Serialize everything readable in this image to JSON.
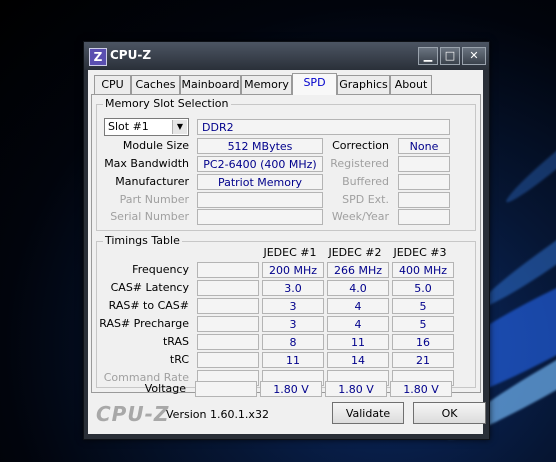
{
  "window": {
    "title": "CPU-Z",
    "icon_letter": "Z"
  },
  "tabs": [
    "CPU",
    "Caches",
    "Mainboard",
    "Memory",
    "SPD",
    "Graphics",
    "About"
  ],
  "active_tab": "SPD",
  "slot_selection": {
    "group_label": "Memory Slot Selection",
    "selected_slot": "Slot #1",
    "memory_type": "DDR2",
    "module_size_label": "Module Size",
    "module_size": "512 MBytes",
    "max_bandwidth_label": "Max Bandwidth",
    "max_bandwidth": "PC2-6400 (400 MHz)",
    "manufacturer_label": "Manufacturer",
    "manufacturer": "Patriot Memory",
    "part_number_label": "Part Number",
    "part_number": "",
    "serial_number_label": "Serial Number",
    "serial_number": "",
    "correction_label": "Correction",
    "correction": "None",
    "registered_label": "Registered",
    "registered": "",
    "buffered_label": "Buffered",
    "buffered": "",
    "spd_ext_label": "SPD Ext.",
    "spd_ext": "",
    "week_year_label": "Week/Year",
    "week_year": ""
  },
  "timings": {
    "group_label": "Timings Table",
    "columns": [
      "JEDEC #1",
      "JEDEC #2",
      "JEDEC #3"
    ],
    "rows": [
      {
        "label": "Frequency",
        "values": [
          "200 MHz",
          "266 MHz",
          "400 MHz"
        ]
      },
      {
        "label": "CAS# Latency",
        "values": [
          "3.0",
          "4.0",
          "5.0"
        ]
      },
      {
        "label": "RAS# to CAS#",
        "values": [
          "3",
          "4",
          "5"
        ]
      },
      {
        "label": "RAS# Precharge",
        "values": [
          "3",
          "4",
          "5"
        ]
      },
      {
        "label": "tRAS",
        "values": [
          "8",
          "11",
          "16"
        ]
      },
      {
        "label": "tRC",
        "values": [
          "11",
          "14",
          "21"
        ]
      },
      {
        "label": "Command Rate",
        "values": [
          "",
          "",
          ""
        ]
      },
      {
        "label": "Voltage",
        "values": [
          "1.80 V",
          "1.80 V",
          "1.80 V"
        ]
      }
    ]
  },
  "footer": {
    "logo": "CPU-Z",
    "version": "Version 1.60.1.x32",
    "validate_label": "Validate",
    "ok_label": "OK"
  }
}
